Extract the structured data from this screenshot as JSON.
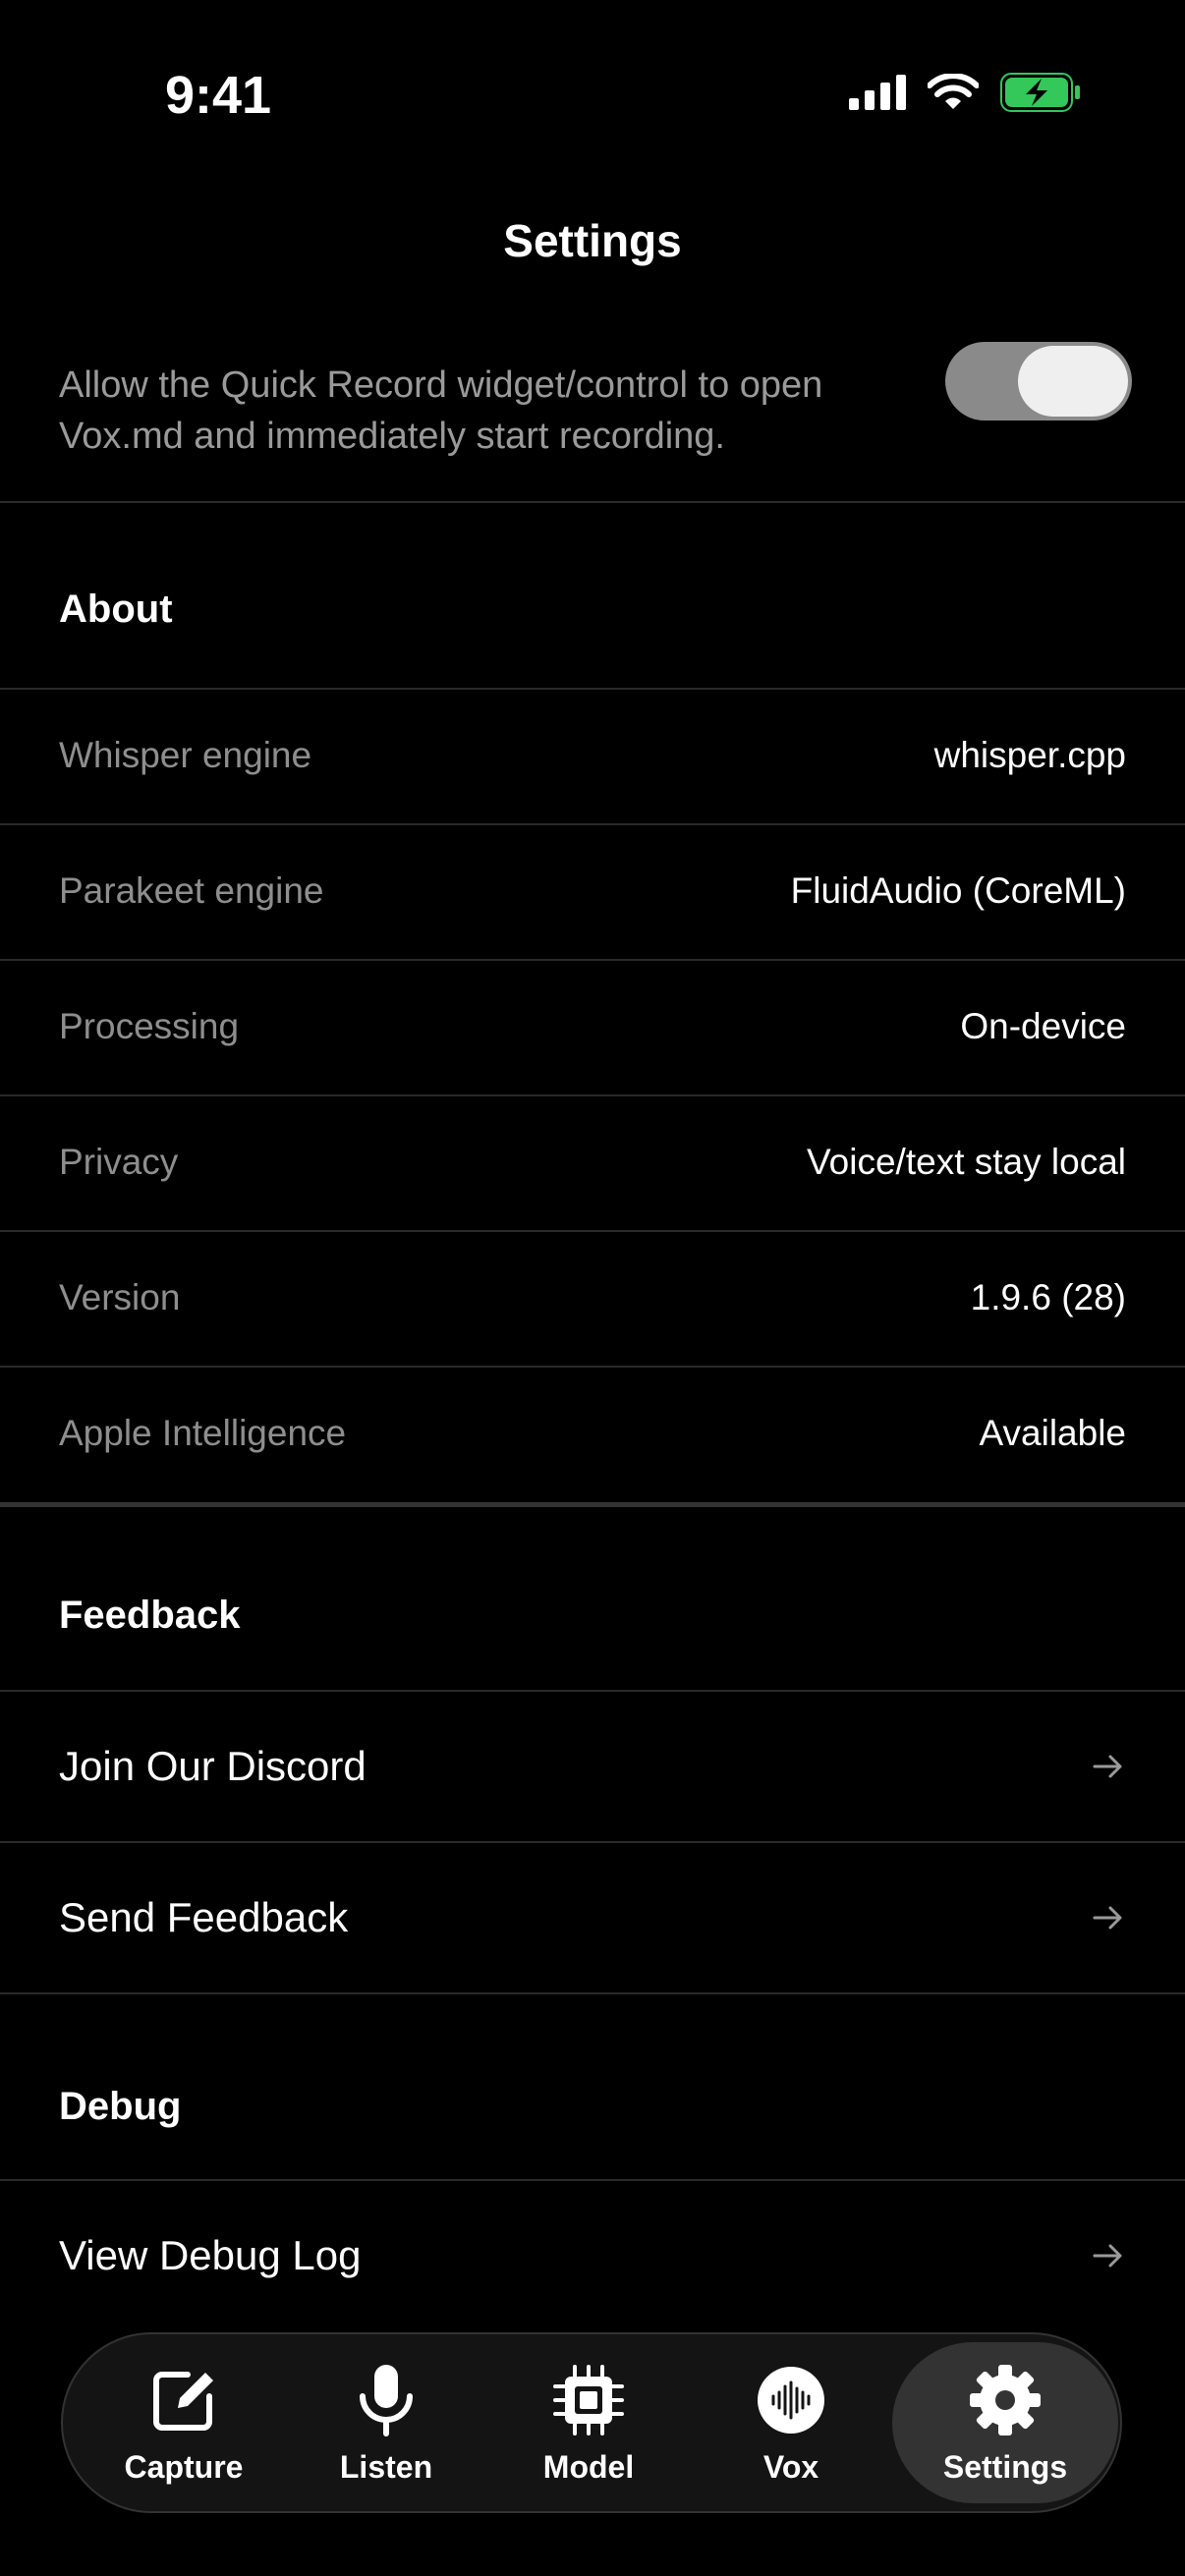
{
  "status_bar": {
    "time": "9:41"
  },
  "nav": {
    "title": "Settings"
  },
  "quick_record": {
    "description": "Allow the Quick Record widget/control to open Vox.md and immediately start recording.",
    "enabled": true
  },
  "about": {
    "header": "About",
    "rows": [
      {
        "label": "Whisper engine",
        "value": "whisper.cpp"
      },
      {
        "label": "Parakeet engine",
        "value": "FluidAudio (CoreML)"
      },
      {
        "label": "Processing",
        "value": "On-device"
      },
      {
        "label": "Privacy",
        "value": "Voice/text stay local"
      },
      {
        "label": "Version",
        "value": "1.9.6 (28)"
      },
      {
        "label": "Apple Intelligence",
        "value": "Available"
      }
    ]
  },
  "feedback": {
    "header": "Feedback",
    "items": [
      {
        "label": "Join Our Discord"
      },
      {
        "label": "Send Feedback"
      }
    ]
  },
  "debug": {
    "header": "Debug",
    "items": [
      {
        "label": "View Debug Log"
      }
    ]
  },
  "tab_bar": {
    "tabs": [
      {
        "label": "Capture",
        "icon": "compose-icon"
      },
      {
        "label": "Listen",
        "icon": "microphone-icon"
      },
      {
        "label": "Model",
        "icon": "chip-icon"
      },
      {
        "label": "Vox",
        "icon": "waveform-icon"
      },
      {
        "label": "Settings",
        "icon": "gear-icon"
      }
    ],
    "active": "Settings"
  },
  "colors": {
    "background": "#000000",
    "battery": "#34c759",
    "secondary_text": "#8e8e8e"
  }
}
